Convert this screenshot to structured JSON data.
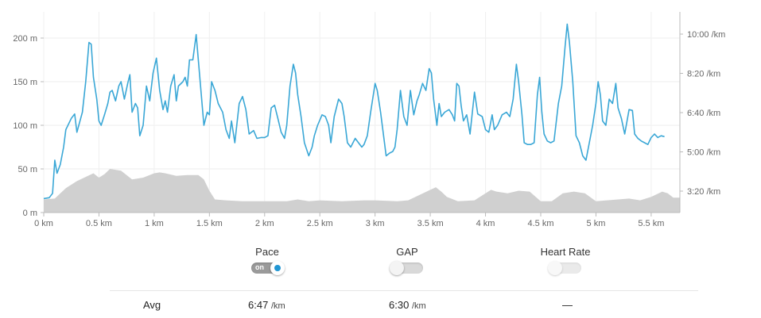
{
  "chart_data": {
    "type": "line",
    "x_unit": "km",
    "x_ticks": [
      "0 km",
      "0.5 km",
      "1 km",
      "1.5 km",
      "2 km",
      "2.5 km",
      "3 km",
      "3.5 km",
      "4 km",
      "4.5 km",
      "5 km",
      "5.5 km"
    ],
    "xlim": [
      0,
      5.76
    ],
    "elevation_axis": {
      "ticks": [
        "0 m",
        "50 m",
        "100 m",
        "150 m",
        "200 m"
      ],
      "ylim": [
        0,
        230
      ]
    },
    "pace_axis": {
      "ticks": [
        "3:20 /km",
        "5:00 /km",
        "6:40 /km",
        "8:20 /km",
        "10:00 /km"
      ]
    },
    "series": [
      {
        "axis": "left",
        "type": "line",
        "color": "#3aa7d6",
        "points": [
          [
            0,
            16
          ],
          [
            0.05,
            17
          ],
          [
            0.08,
            22
          ],
          [
            0.1,
            60
          ],
          [
            0.12,
            45
          ],
          [
            0.15,
            55
          ],
          [
            0.18,
            75
          ],
          [
            0.2,
            95
          ],
          [
            0.25,
            108
          ],
          [
            0.28,
            113
          ],
          [
            0.3,
            92
          ],
          [
            0.35,
            115
          ],
          [
            0.38,
            150
          ],
          [
            0.41,
            195
          ],
          [
            0.43,
            193
          ],
          [
            0.45,
            155
          ],
          [
            0.48,
            130
          ],
          [
            0.5,
            105
          ],
          [
            0.52,
            100
          ],
          [
            0.55,
            112
          ],
          [
            0.58,
            125
          ],
          [
            0.6,
            138
          ],
          [
            0.62,
            140
          ],
          [
            0.65,
            128
          ],
          [
            0.68,
            145
          ],
          [
            0.7,
            150
          ],
          [
            0.73,
            130
          ],
          [
            0.76,
            148
          ],
          [
            0.78,
            158
          ],
          [
            0.8,
            115
          ],
          [
            0.83,
            125
          ],
          [
            0.85,
            120
          ],
          [
            0.87,
            88
          ],
          [
            0.9,
            100
          ],
          [
            0.93,
            145
          ],
          [
            0.96,
            128
          ],
          [
            0.99,
            160
          ],
          [
            1.02,
            177
          ],
          [
            1.05,
            140
          ],
          [
            1.08,
            118
          ],
          [
            1.1,
            128
          ],
          [
            1.12,
            115
          ],
          [
            1.15,
            145
          ],
          [
            1.18,
            158
          ],
          [
            1.2,
            128
          ],
          [
            1.22,
            145
          ],
          [
            1.26,
            150
          ],
          [
            1.28,
            155
          ],
          [
            1.3,
            145
          ],
          [
            1.32,
            175
          ],
          [
            1.35,
            175
          ],
          [
            1.38,
            204
          ],
          [
            1.4,
            175
          ],
          [
            1.42,
            145
          ],
          [
            1.45,
            100
          ],
          [
            1.48,
            115
          ],
          [
            1.5,
            112
          ],
          [
            1.52,
            150
          ],
          [
            1.55,
            140
          ],
          [
            1.58,
            125
          ],
          [
            1.62,
            115
          ],
          [
            1.65,
            95
          ],
          [
            1.68,
            85
          ],
          [
            1.7,
            105
          ],
          [
            1.73,
            80
          ],
          [
            1.77,
            125
          ],
          [
            1.8,
            133
          ],
          [
            1.83,
            118
          ],
          [
            1.86,
            90
          ],
          [
            1.9,
            94
          ],
          [
            1.93,
            85
          ],
          [
            1.97,
            86
          ],
          [
            2.0,
            86
          ],
          [
            2.03,
            88
          ],
          [
            2.06,
            120
          ],
          [
            2.09,
            123
          ],
          [
            2.12,
            108
          ],
          [
            2.15,
            92
          ],
          [
            2.18,
            85
          ],
          [
            2.2,
            100
          ],
          [
            2.23,
            145
          ],
          [
            2.26,
            170
          ],
          [
            2.28,
            160
          ],
          [
            2.3,
            135
          ],
          [
            2.33,
            110
          ],
          [
            2.36,
            80
          ],
          [
            2.4,
            65
          ],
          [
            2.43,
            75
          ],
          [
            2.45,
            88
          ],
          [
            2.48,
            100
          ],
          [
            2.52,
            112
          ],
          [
            2.55,
            110
          ],
          [
            2.58,
            100
          ],
          [
            2.6,
            80
          ],
          [
            2.63,
            110
          ],
          [
            2.67,
            130
          ],
          [
            2.7,
            125
          ],
          [
            2.72,
            110
          ],
          [
            2.75,
            80
          ],
          [
            2.78,
            75
          ],
          [
            2.82,
            85
          ],
          [
            2.85,
            80
          ],
          [
            2.88,
            75
          ],
          [
            2.9,
            78
          ],
          [
            2.93,
            88
          ],
          [
            2.96,
            115
          ],
          [
            3.0,
            148
          ],
          [
            3.02,
            140
          ],
          [
            3.05,
            115
          ],
          [
            3.08,
            85
          ],
          [
            3.1,
            65
          ],
          [
            3.13,
            68
          ],
          [
            3.16,
            70
          ],
          [
            3.18,
            75
          ],
          [
            3.2,
            95
          ],
          [
            3.23,
            140
          ],
          [
            3.26,
            110
          ],
          [
            3.29,
            100
          ],
          [
            3.32,
            140
          ],
          [
            3.35,
            112
          ],
          [
            3.38,
            128
          ],
          [
            3.4,
            135
          ],
          [
            3.43,
            148
          ],
          [
            3.46,
            140
          ],
          [
            3.49,
            165
          ],
          [
            3.51,
            160
          ],
          [
            3.53,
            130
          ],
          [
            3.56,
            100
          ],
          [
            3.58,
            125
          ],
          [
            3.6,
            110
          ],
          [
            3.63,
            115
          ],
          [
            3.67,
            118
          ],
          [
            3.7,
            112
          ],
          [
            3.72,
            105
          ],
          [
            3.74,
            148
          ],
          [
            3.76,
            145
          ],
          [
            3.78,
            122
          ],
          [
            3.8,
            105
          ],
          [
            3.83,
            112
          ],
          [
            3.86,
            90
          ],
          [
            3.9,
            138
          ],
          [
            3.93,
            113
          ],
          [
            3.97,
            110
          ],
          [
            4.0,
            95
          ],
          [
            4.03,
            92
          ],
          [
            4.06,
            112
          ],
          [
            4.08,
            95
          ],
          [
            4.11,
            100
          ],
          [
            4.15,
            112
          ],
          [
            4.19,
            115
          ],
          [
            4.22,
            110
          ],
          [
            4.25,
            130
          ],
          [
            4.28,
            170
          ],
          [
            4.3,
            150
          ],
          [
            4.33,
            112
          ],
          [
            4.35,
            80
          ],
          [
            4.38,
            78
          ],
          [
            4.41,
            78
          ],
          [
            4.44,
            80
          ],
          [
            4.47,
            135
          ],
          [
            4.49,
            155
          ],
          [
            4.51,
            115
          ],
          [
            4.53,
            90
          ],
          [
            4.56,
            82
          ],
          [
            4.59,
            80
          ],
          [
            4.62,
            82
          ],
          [
            4.66,
            125
          ],
          [
            4.69,
            145
          ],
          [
            4.72,
            190
          ],
          [
            4.74,
            216
          ],
          [
            4.76,
            195
          ],
          [
            4.79,
            150
          ],
          [
            4.82,
            88
          ],
          [
            4.85,
            80
          ],
          [
            4.88,
            65
          ],
          [
            4.91,
            60
          ],
          [
            4.94,
            80
          ],
          [
            4.97,
            100
          ],
          [
            5.0,
            125
          ],
          [
            5.02,
            150
          ],
          [
            5.04,
            135
          ],
          [
            5.06,
            105
          ],
          [
            5.09,
            100
          ],
          [
            5.12,
            130
          ],
          [
            5.15,
            125
          ],
          [
            5.18,
            148
          ],
          [
            5.2,
            120
          ],
          [
            5.23,
            108
          ],
          [
            5.26,
            90
          ],
          [
            5.3,
            118
          ],
          [
            5.33,
            117
          ],
          [
            5.35,
            90
          ],
          [
            5.38,
            85
          ],
          [
            5.41,
            82
          ],
          [
            5.44,
            80
          ],
          [
            5.47,
            78
          ],
          [
            5.5,
            86
          ],
          [
            5.53,
            90
          ],
          [
            5.56,
            86
          ],
          [
            5.59,
            88
          ],
          [
            5.62,
            87
          ]
        ]
      },
      {
        "axis": "left",
        "type": "area",
        "color": "#d0d0d0",
        "points": [
          [
            0,
            15
          ],
          [
            0.1,
            16
          ],
          [
            0.2,
            28
          ],
          [
            0.3,
            36
          ],
          [
            0.4,
            42
          ],
          [
            0.45,
            45
          ],
          [
            0.5,
            40
          ],
          [
            0.55,
            44
          ],
          [
            0.6,
            50
          ],
          [
            0.7,
            48
          ],
          [
            0.8,
            38
          ],
          [
            0.9,
            40
          ],
          [
            1.0,
            45
          ],
          [
            1.05,
            46
          ],
          [
            1.1,
            45
          ],
          [
            1.2,
            42
          ],
          [
            1.3,
            43
          ],
          [
            1.4,
            43
          ],
          [
            1.45,
            38
          ],
          [
            1.5,
            25
          ],
          [
            1.55,
            15
          ],
          [
            1.65,
            14
          ],
          [
            1.8,
            13
          ],
          [
            2.0,
            13
          ],
          [
            2.2,
            13
          ],
          [
            2.3,
            15
          ],
          [
            2.4,
            13
          ],
          [
            2.5,
            14
          ],
          [
            2.7,
            13
          ],
          [
            2.9,
            14
          ],
          [
            3.0,
            14
          ],
          [
            3.2,
            13
          ],
          [
            3.3,
            14
          ],
          [
            3.4,
            20
          ],
          [
            3.5,
            26
          ],
          [
            3.55,
            29
          ],
          [
            3.6,
            24
          ],
          [
            3.65,
            18
          ],
          [
            3.75,
            13
          ],
          [
            3.9,
            14
          ],
          [
            4.0,
            22
          ],
          [
            4.05,
            26
          ],
          [
            4.1,
            24
          ],
          [
            4.2,
            22
          ],
          [
            4.3,
            25
          ],
          [
            4.4,
            24
          ],
          [
            4.5,
            13
          ],
          [
            4.6,
            13
          ],
          [
            4.7,
            22
          ],
          [
            4.8,
            24
          ],
          [
            4.9,
            22
          ],
          [
            5.0,
            13
          ],
          [
            5.1,
            14
          ],
          [
            5.2,
            15
          ],
          [
            5.3,
            16
          ],
          [
            5.4,
            14
          ],
          [
            5.5,
            18
          ],
          [
            5.6,
            24
          ],
          [
            5.65,
            22
          ],
          [
            5.7,
            17
          ],
          [
            5.76,
            17
          ]
        ]
      }
    ]
  },
  "controls": {
    "pace": {
      "label": "Pace",
      "toggle_text": "on",
      "state": "on"
    },
    "gap": {
      "label": "GAP",
      "state": "off"
    },
    "heart_rate": {
      "label": "Heart Rate",
      "state": "off"
    }
  },
  "summary": {
    "row_label": "Avg",
    "pace_value": "6:47",
    "pace_unit": "/km",
    "gap_value": "6:30",
    "gap_unit": "/km",
    "heart_rate_value": "—"
  }
}
